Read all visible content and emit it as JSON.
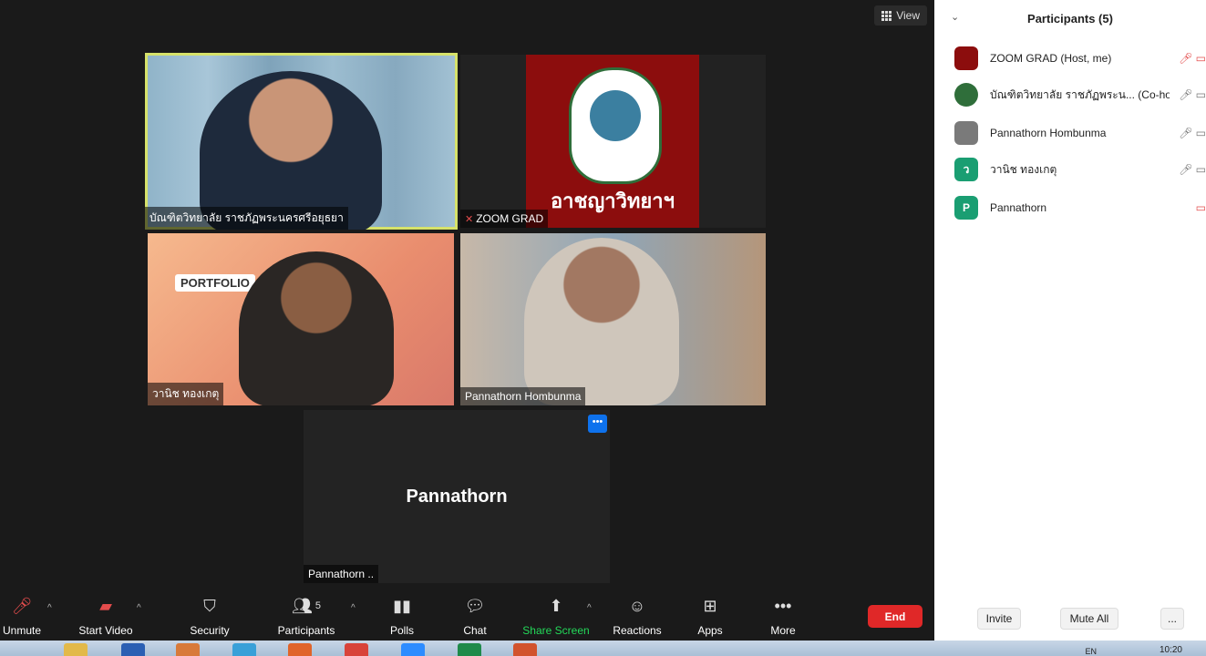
{
  "view": {
    "label": "View"
  },
  "tiles": [
    {
      "name": "บัณฑิตวิทยาลัย ราชภัฏพระนครศรีอยุธยา"
    },
    {
      "name": "ZOOM GRAD",
      "logo_text": "อาชญาวิทยาฯ"
    },
    {
      "name": "วานิช ทองเกตุ",
      "banner": "PORTFOLIO"
    },
    {
      "name": "Pannathorn Hombunma"
    },
    {
      "name": "Pannathorn ..",
      "display": "Pannathorn"
    }
  ],
  "toolbar": {
    "unmute": "Unmute",
    "start_video": "Start Video",
    "security": "Security",
    "participants": "Participants",
    "participants_count": "5",
    "polls": "Polls",
    "chat": "Chat",
    "share_screen": "Share Screen",
    "reactions": "Reactions",
    "apps": "Apps",
    "more": "More",
    "end": "End"
  },
  "panel": {
    "title": "Participants (5)",
    "participants": [
      {
        "name": "ZOOM GRAD (Host, me)",
        "avatar": "",
        "avatar_color": "#8c0d0d"
      },
      {
        "name": "บัณฑิตวิทยาลัย ราชภัฏพระน...",
        "role": "(Co-host)",
        "avatar": "",
        "avatar_color": "#2f6e3a"
      },
      {
        "name": "Pannathorn Hombunma",
        "avatar": "",
        "avatar_color": "#7a7a7a"
      },
      {
        "name": "วานิช ทองเกตุ",
        "avatar": "ว",
        "avatar_color": "#1a9e72"
      },
      {
        "name": "Pannathorn",
        "avatar": "P",
        "avatar_color": "#1a9e72"
      }
    ],
    "invite": "Invite",
    "mute_all": "Mute All",
    "more": "..."
  },
  "taskbar": {
    "lang": "EN",
    "time": "10:20"
  },
  "colors": {
    "accent": "#0e72ed",
    "end": "#e02828",
    "share": "#23d959",
    "active_speaker": "#d6e26a"
  }
}
